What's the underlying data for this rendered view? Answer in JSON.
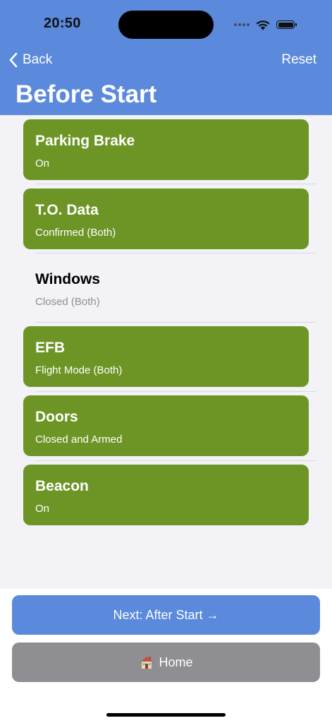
{
  "status_bar": {
    "time": "20:50"
  },
  "nav": {
    "back_label": "Back",
    "reset_label": "Reset",
    "title": "Before Start"
  },
  "checklist": [
    {
      "title": "Parking Brake",
      "subtitle": "On",
      "checked": true
    },
    {
      "title": "T.O. Data",
      "subtitle": "Confirmed (Both)",
      "checked": true
    },
    {
      "title": "Windows",
      "subtitle": "Closed (Both)",
      "checked": false
    },
    {
      "title": "EFB",
      "subtitle": "Flight Mode (Both)",
      "checked": true
    },
    {
      "title": "Doors",
      "subtitle": "Closed and Armed",
      "checked": true
    },
    {
      "title": "Beacon",
      "subtitle": "On",
      "checked": true
    }
  ],
  "buttons": {
    "next_label": "Next: After Start →",
    "home_label": "Home",
    "home_icon": "house-icon"
  },
  "colors": {
    "header": "#5b89db",
    "checked_item": "#6d9526",
    "next_button": "#5b89db",
    "home_button": "#8e8e93"
  }
}
